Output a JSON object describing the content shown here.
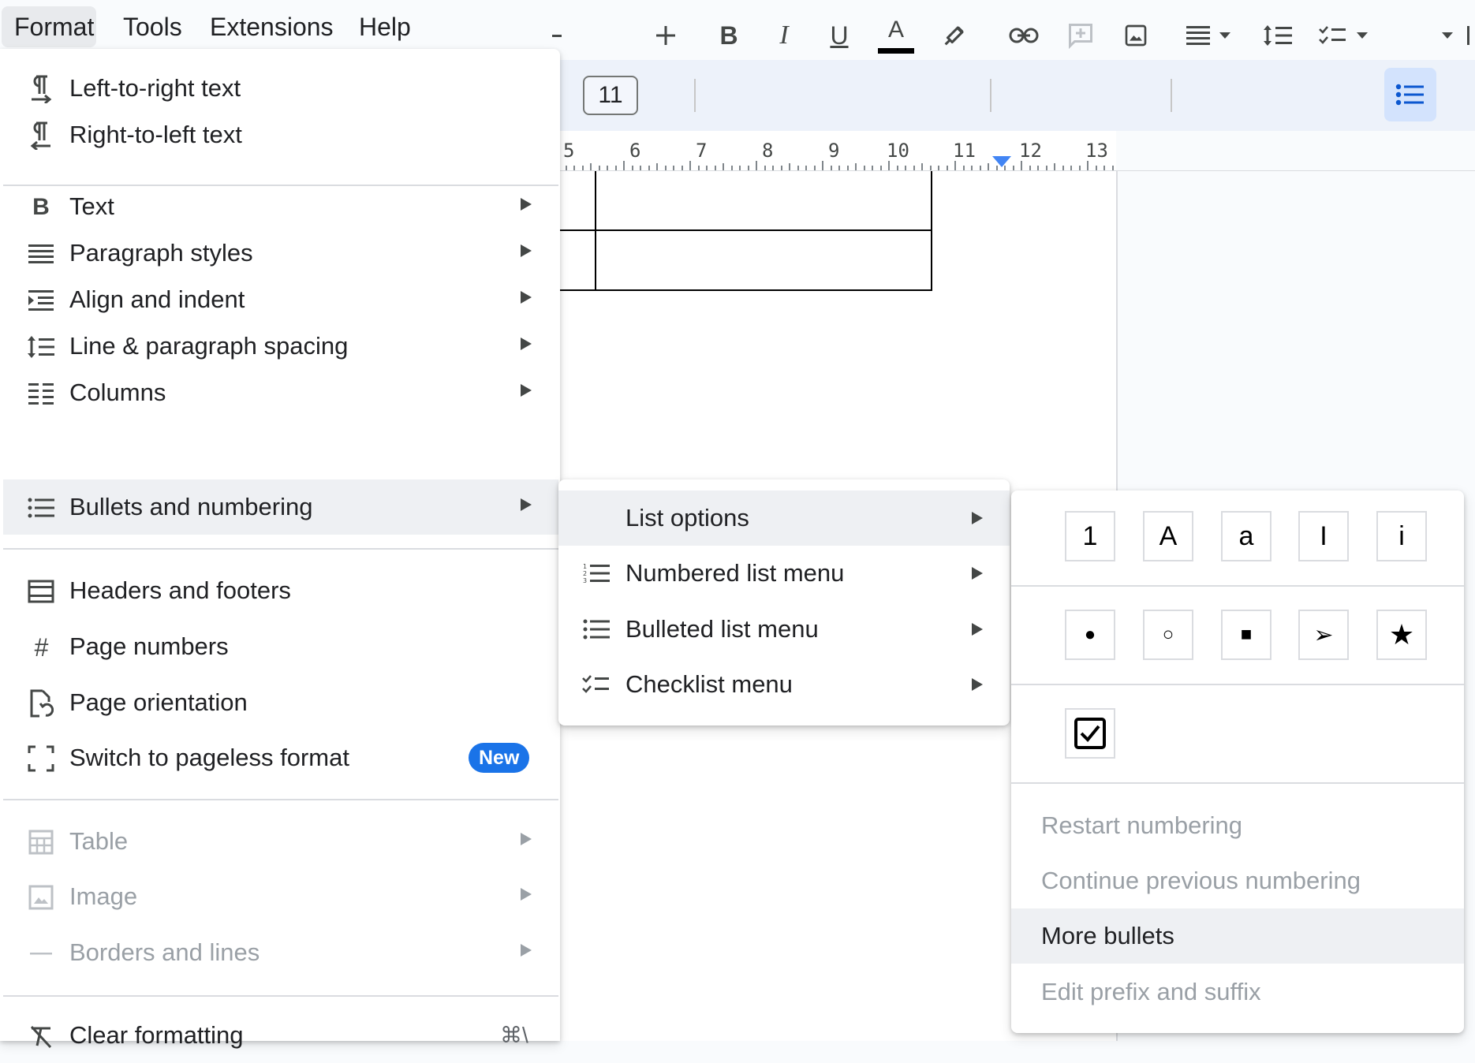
{
  "menubar": {
    "items": [
      {
        "label": "Format"
      },
      {
        "label": "Tools"
      },
      {
        "label": "Extensions"
      },
      {
        "label": "Help"
      }
    ]
  },
  "toolbar": {
    "font_size": "11",
    "icons": [
      "minus-icon",
      "plus-icon",
      "bold-icon",
      "italic-icon",
      "underline-icon",
      "text-color-icon",
      "highlight-icon",
      "link-icon",
      "add-comment-icon",
      "insert-image-icon",
      "align-icon",
      "line-spacing-icon",
      "checklist-icon",
      "bulleted-list-icon"
    ],
    "bold": "B",
    "italic": "I",
    "underline": "U",
    "text_color_glyph": "A",
    "text_color": "#000000"
  },
  "ruler": {
    "numbers": [
      "5",
      "6",
      "7",
      "8",
      "9",
      "10",
      "11",
      "12",
      "13"
    ]
  },
  "format_menu": {
    "items": [
      {
        "label": "Left-to-right text",
        "icon": "ltr-text-icon"
      },
      {
        "label": "Right-to-left text",
        "icon": "rtl-text-icon"
      },
      {
        "label": "Text",
        "icon": "bold-b-icon",
        "submenu": true
      },
      {
        "label": "Paragraph styles",
        "icon": "paragraph-styles-icon",
        "submenu": true
      },
      {
        "label": "Align and indent",
        "icon": "align-indent-icon",
        "submenu": true
      },
      {
        "label": "Line & paragraph spacing",
        "icon": "line-spacing-icon",
        "submenu": true
      },
      {
        "label": "Columns",
        "icon": "columns-icon",
        "submenu": true
      },
      {
        "label": "Bullets and numbering",
        "icon": "bullets-icon",
        "submenu": true,
        "highlighted": true
      },
      {
        "label": "Headers and footers",
        "icon": "headers-footers-icon"
      },
      {
        "label": "Page numbers",
        "icon": "hash-icon"
      },
      {
        "label": "Page orientation",
        "icon": "page-orientation-icon"
      },
      {
        "label": "Switch to pageless format",
        "icon": "pageless-icon",
        "badge": "New"
      },
      {
        "label": "Table",
        "icon": "table-icon",
        "submenu": true,
        "disabled": true
      },
      {
        "label": "Image",
        "icon": "image-icon",
        "submenu": true,
        "disabled": true
      },
      {
        "label": "Borders and lines",
        "icon": "borders-lines-icon",
        "submenu": true,
        "disabled": true
      },
      {
        "label": "Clear formatting",
        "icon": "clear-formatting-icon",
        "shortcut": "⌘\\"
      }
    ]
  },
  "bullets_submenu": {
    "items": [
      {
        "label": "List options",
        "submenu": true,
        "highlighted": true
      },
      {
        "label": "Numbered list menu",
        "icon": "numbered-list-icon",
        "submenu": true
      },
      {
        "label": "Bulleted list menu",
        "icon": "bulleted-list-icon",
        "submenu": true
      },
      {
        "label": "Checklist menu",
        "icon": "checklist-icon",
        "submenu": true
      }
    ]
  },
  "list_options": {
    "numbering_styles": [
      "1",
      "A",
      "a",
      "I",
      "i"
    ],
    "bullet_styles": [
      "●",
      "○",
      "■",
      "➢",
      "★"
    ],
    "checklist_style": "checkbox",
    "actions": [
      {
        "label": "Restart numbering",
        "enabled": false
      },
      {
        "label": "Continue previous numbering",
        "enabled": false
      },
      {
        "label": "More bullets",
        "enabled": true,
        "highlighted": true
      },
      {
        "label": "Edit prefix and suffix",
        "enabled": false
      }
    ]
  },
  "colors": {
    "accent": "#1a73e8",
    "ruler_marker": "#4285f4",
    "toolbar_bg": "#edf2fa",
    "hover_bg": "#eef0f3",
    "active_toggle_bg": "#d3e3fd"
  }
}
